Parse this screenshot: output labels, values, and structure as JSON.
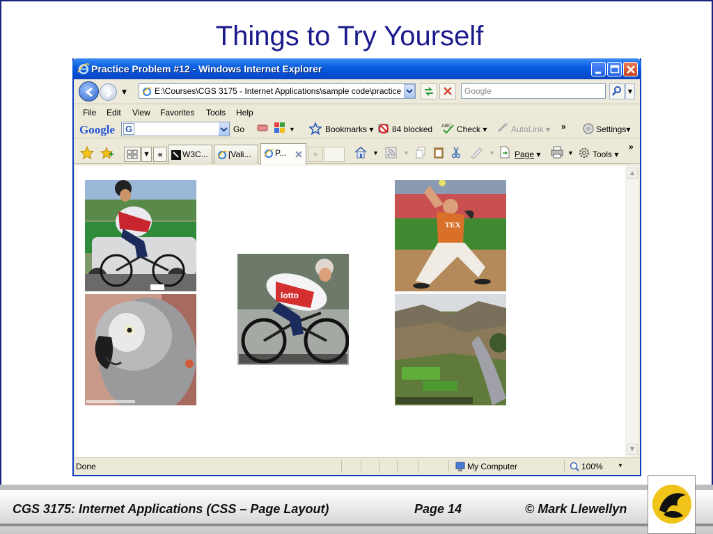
{
  "slide": {
    "title": "Things to Try Yourself"
  },
  "window": {
    "title": "Practice Problem #12 - Windows Internet Explorer"
  },
  "address": {
    "url": "E:\\Courses\\CGS 3175 - Internet Applications\\sample code\\practice pr",
    "search_placeholder": "Google"
  },
  "menu": [
    "File",
    "Edit",
    "View",
    "Favorites",
    "Tools",
    "Help"
  ],
  "googlebar": {
    "logo": "Google",
    "badge": "G",
    "go": "Go",
    "bookmarks": "Bookmarks",
    "blocked": "84 blocked",
    "check": "Check",
    "autolink": "AutoLink",
    "more": "»",
    "settings": "Settings"
  },
  "tabs": {
    "quick_prev": "«",
    "items": [
      {
        "label": "W3C..."
      },
      {
        "label": "[Vali..."
      },
      {
        "label": "P..."
      }
    ],
    "quick_next": "»",
    "page": "Page",
    "tools": "Tools",
    "more": "»"
  },
  "status": {
    "text": "Done",
    "zone": "My Computer",
    "zoom": "100%"
  },
  "footer": {
    "course": "CGS 3175: Internet Applications (CSS – Page Layout)",
    "page": "Page 14",
    "author": "© Mark Llewellyn"
  },
  "colors": {
    "title": "#1a1a8c",
    "ie_blue": "#0a5ee0",
    "chrome": "#ece9d8"
  }
}
